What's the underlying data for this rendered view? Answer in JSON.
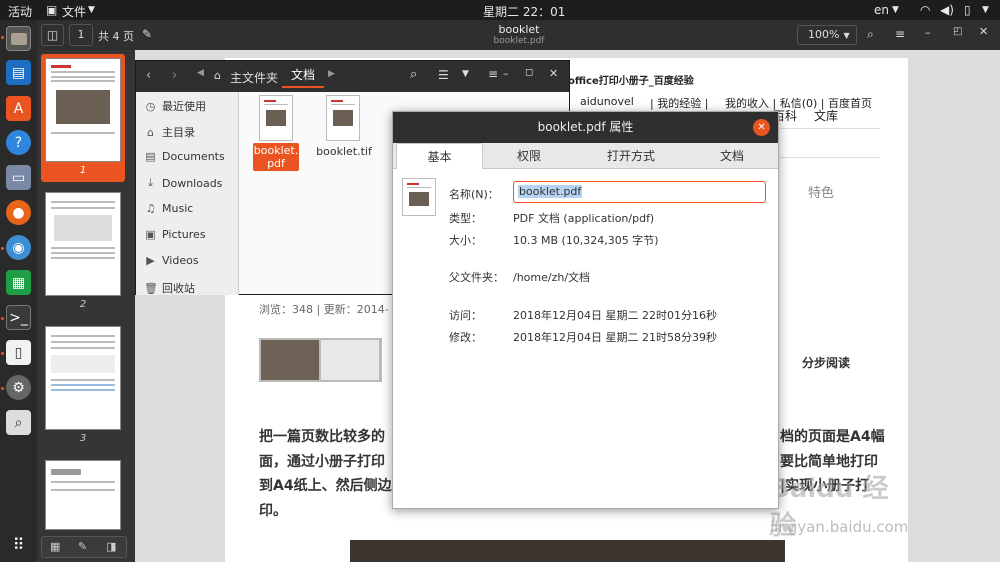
{
  "topbar": {
    "activities": "活动",
    "app_menu": "文件",
    "clock": "星期二 22：01",
    "lang": "en"
  },
  "viewer": {
    "title": "booklet",
    "subtitle": "booklet.pdf",
    "page_current": "1",
    "page_total": "共 4 页",
    "zoom": "100%",
    "thumb_numbers": [
      "1",
      "2",
      "3"
    ]
  },
  "document": {
    "header_title": "office打印小册子_百度经验",
    "nav_user": "aidunovel",
    "nav_links": "| 我的经验 |",
    "nav_right": "我的收入 | 私信(0) | 百度首页",
    "nav_right2": "百科",
    "nav_right3": "文库",
    "tag": "特色",
    "stats": "浏览：348 | 更新：2014-",
    "step_read": "分步阅读",
    "body_line1_left": "把一篇页数比较多的",
    "body_line1_right": "档的页面是A4幅",
    "body_line2_left": "面，通过小册子打印",
    "body_line2_right": "要比简单地打印",
    "body_line3_left": "到A4纸上、然后侧边",
    "body_line3_right": "|实现小册子打",
    "body_line4": "印。",
    "watermark_brand": "Baidu 经验",
    "watermark_url": "jingyan.baidu.com"
  },
  "nautilus": {
    "path_home": "主文件夹",
    "path_current": "文档",
    "sidebar": [
      {
        "icon": "clock-icon",
        "label": "最近使用"
      },
      {
        "icon": "home-icon",
        "label": "主目录"
      },
      {
        "icon": "document-icon",
        "label": "Documents"
      },
      {
        "icon": "download-icon",
        "label": "Downloads"
      },
      {
        "icon": "music-icon",
        "label": "Music"
      },
      {
        "icon": "picture-icon",
        "label": "Pictures"
      },
      {
        "icon": "video-icon",
        "label": "Videos"
      },
      {
        "icon": "trash-icon",
        "label": "回收站"
      }
    ],
    "files": [
      {
        "name_line1": "booklet.",
        "name_line2": "pdf",
        "selected": true
      },
      {
        "name_line1": "booklet.tif",
        "name_line2": "",
        "selected": false
      }
    ]
  },
  "dialog": {
    "title": "booklet.pdf 属性",
    "tabs": [
      "基本",
      "权限",
      "打开方式",
      "文档"
    ],
    "name_label": "名称(N)：",
    "name_value": "booklet.pdf",
    "type_label": "类型：",
    "type_value": "PDF 文档 (application/pdf)",
    "size_label": "大小：",
    "size_value": "10.3 MB (10,324,305 字节)",
    "parent_label": "父文件夹：",
    "parent_value": "/home/zh/文档",
    "access_label": "访问：",
    "access_value": "2018年12月04日 星期二 22时01分16秒",
    "modified_label": "修改：",
    "modified_value": "2018年12月04日 星期二 21时58分39秒"
  },
  "colors": {
    "accent": "#e95420",
    "selection": "#b6d4f2"
  }
}
